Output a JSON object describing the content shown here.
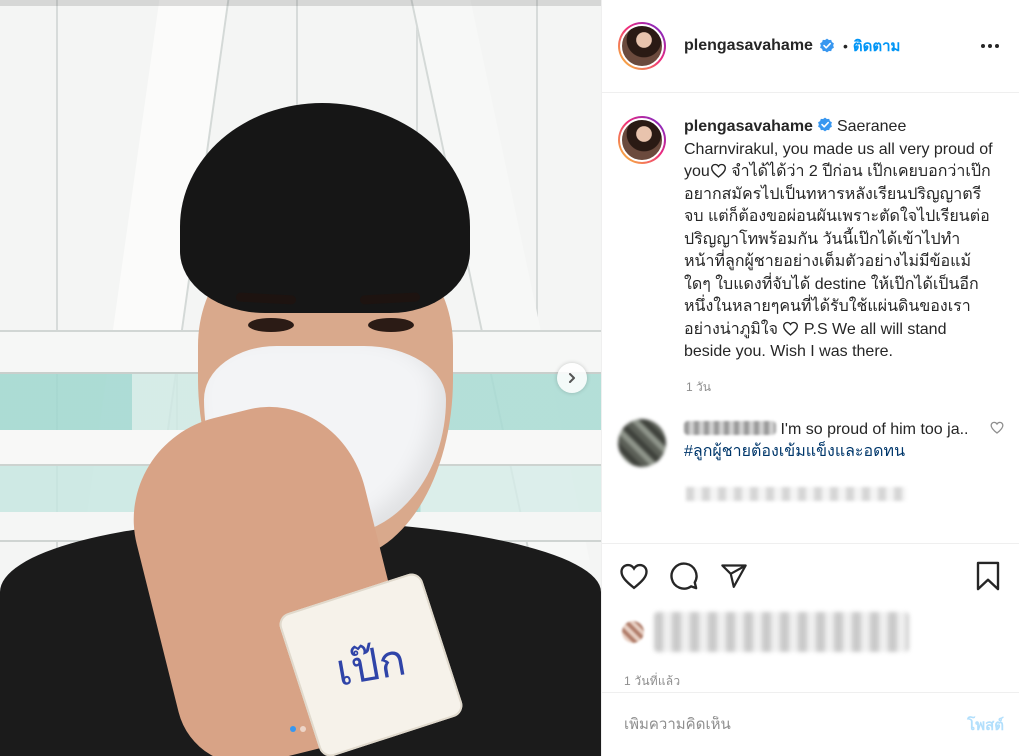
{
  "post": {
    "username": "plengasavahame",
    "follow_separator": "•",
    "follow_label": "ติดตาม",
    "caption_mention": "Saeranee Charnvirakul,",
    "caption_line_1": " you made us all very proud of you",
    "caption_line_2": " จำได้ได้ว่า 2 ปีก่อน เป๊กเคยบอกว่าเป๊กอยากสมัครไปเป็นทหารหลังเรียนปริญญาตรีจบ แต่ก็ต้องขอผ่อนผันเพราะตัดใจไปเรียนต่อปริญญาโทพร้อมกัน วันนี้เป๊กได้เข้าไปทำหน้าที่ลูกผู้ชายอย่างเต็มตัวอย่างไม่มีข้อแม้ใดๆ ใบแดงที่จับได้ destine ให้เป๊กได้เป็นอีกหนึ่งในหลายๆคนที่ได้รับใช้แผ่นดินของเราอย่างน่าภูมิใจ",
    "caption_line_3": " P.S We all will stand beside you. Wish I was there.",
    "caption_time": "1 วัน",
    "wristband_text": "เป๊ก"
  },
  "comment": {
    "text": " I'm so proud of him too ja.. ",
    "hashtag": "#ลูกผู้ชายต้องเข้มแข็งและอดทน"
  },
  "footer": {
    "post_time": "1 วันที่แล้ว",
    "comment_placeholder": "เพิ่มความคิดเห็น",
    "post_button": "โพสต์"
  },
  "colors": {
    "link": "#0095f6",
    "hashtag": "#00376b",
    "muted": "#8e8e8e",
    "post_disabled": "#b2dffc"
  },
  "icons": [
    "verified-badge-icon",
    "more-options-icon",
    "chevron-right-icon",
    "heart-icon",
    "comment-icon",
    "share-icon",
    "bookmark-icon"
  ]
}
